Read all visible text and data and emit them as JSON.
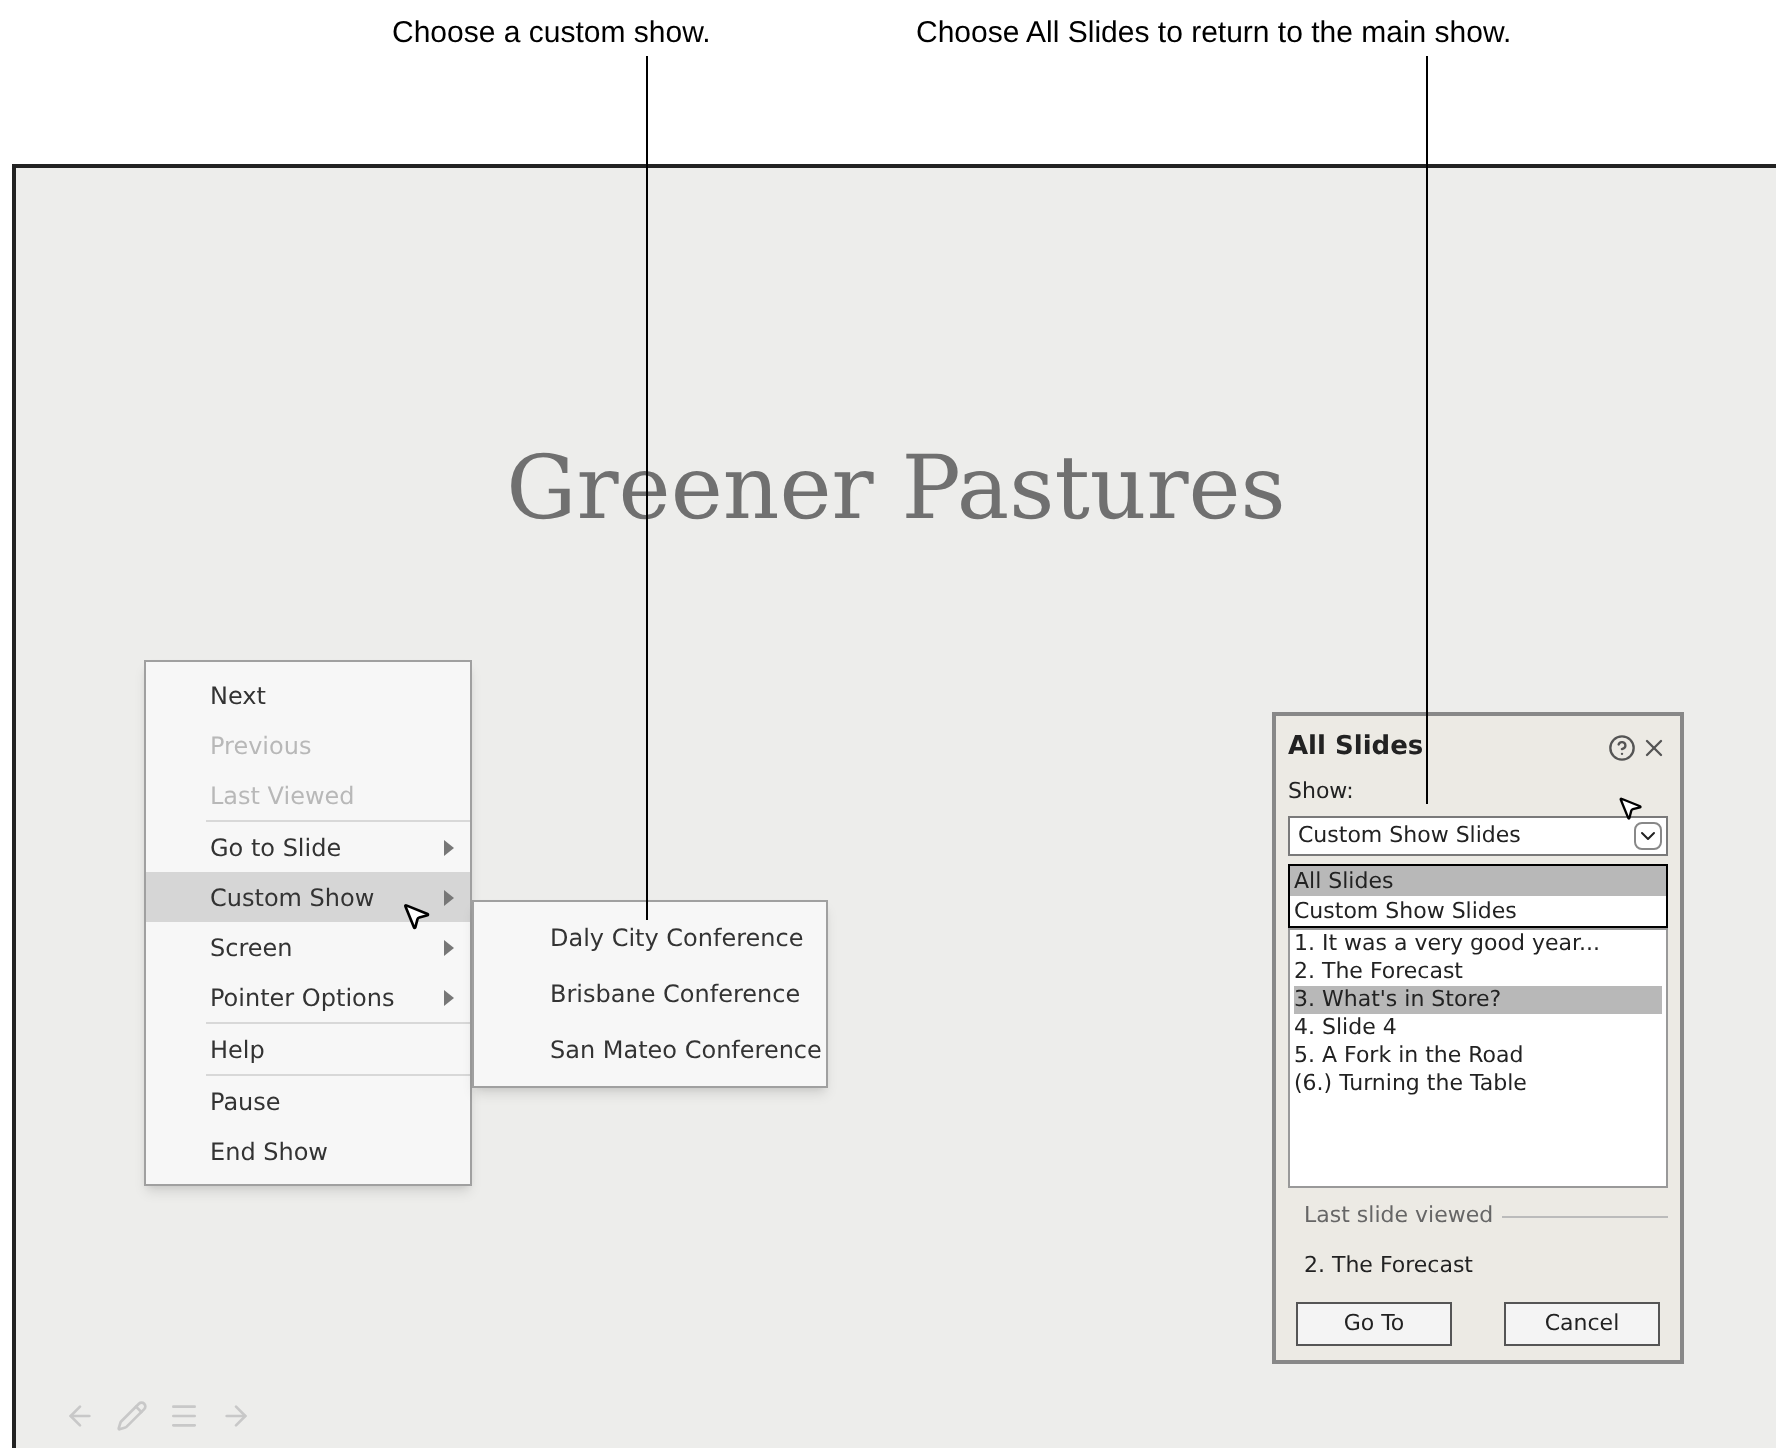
{
  "callouts": [
    {
      "text": "Choose a custom show."
    },
    {
      "text": "Choose All Slides to return to the main show."
    }
  ],
  "slide": {
    "title": "Greener Pastures"
  },
  "context_menu": {
    "groups": [
      [
        {
          "label": "Next",
          "disabled": false,
          "selected": false,
          "submenu": false
        },
        {
          "label": "Previous",
          "disabled": true,
          "selected": false,
          "submenu": false
        },
        {
          "label": "Last Viewed",
          "disabled": true,
          "selected": false,
          "submenu": false
        }
      ],
      [
        {
          "label": "Go to Slide",
          "disabled": false,
          "selected": false,
          "submenu": true
        },
        {
          "label": "Custom Show",
          "disabled": false,
          "selected": true,
          "submenu": true
        },
        {
          "label": "Screen",
          "disabled": false,
          "selected": false,
          "submenu": true
        },
        {
          "label": "Pointer Options",
          "disabled": false,
          "selected": false,
          "submenu": true
        }
      ],
      [
        {
          "label": "Help",
          "disabled": false,
          "selected": false,
          "submenu": false
        }
      ],
      [
        {
          "label": "Pause",
          "disabled": false,
          "selected": false,
          "submenu": false
        },
        {
          "label": "End Show",
          "disabled": false,
          "selected": false,
          "submenu": false
        }
      ]
    ]
  },
  "submenu": {
    "items": [
      "Daly City Conference",
      "Brisbane Conference",
      "San Mateo Conference"
    ]
  },
  "dialog": {
    "title": "All Slides",
    "show_label": "Show:",
    "show_value": "Custom Show Slides",
    "show_options": [
      {
        "label": "All Slides",
        "selected": true
      },
      {
        "label": "Custom Show Slides",
        "selected": false
      }
    ],
    "slides": [
      {
        "label": "1. It was a very good year...",
        "selected": false
      },
      {
        "label": "2. The Forecast",
        "selected": false
      },
      {
        "label": "3. What's in Store?",
        "selected": true
      },
      {
        "label": "4. Slide 4",
        "selected": false
      },
      {
        "label": "5. A Fork in the Road",
        "selected": false
      },
      {
        "label": "(6.) Turning the Table",
        "selected": false
      }
    ],
    "last_viewed_label": "Last slide viewed",
    "last_viewed": "2. The Forecast",
    "buttons": [
      "Go To",
      "Cancel"
    ]
  }
}
